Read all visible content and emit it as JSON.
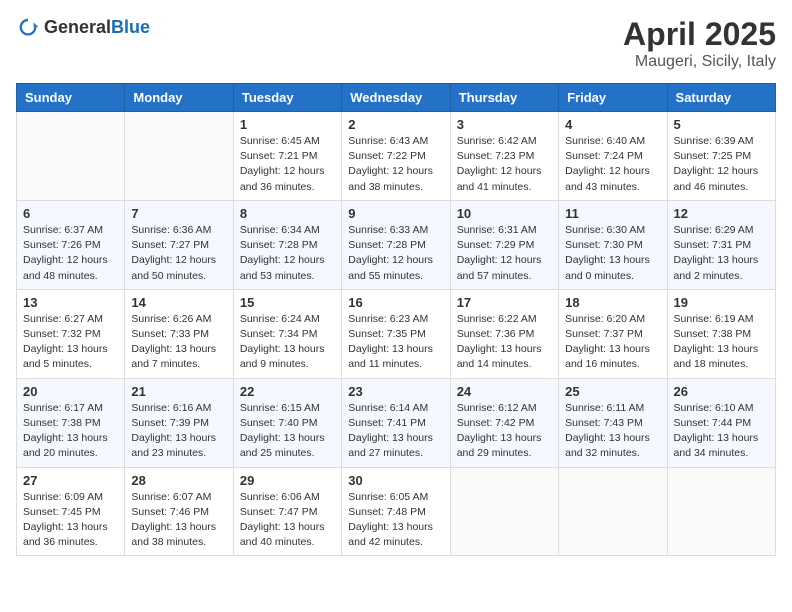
{
  "header": {
    "logo_general": "General",
    "logo_blue": "Blue",
    "month": "April 2025",
    "location": "Maugeri, Sicily, Italy"
  },
  "weekdays": [
    "Sunday",
    "Monday",
    "Tuesday",
    "Wednesday",
    "Thursday",
    "Friday",
    "Saturday"
  ],
  "weeks": [
    [
      {
        "day": "",
        "empty": true
      },
      {
        "day": "",
        "empty": true
      },
      {
        "day": "1",
        "sunrise": "6:45 AM",
        "sunset": "7:21 PM",
        "daylight": "12 hours and 36 minutes."
      },
      {
        "day": "2",
        "sunrise": "6:43 AM",
        "sunset": "7:22 PM",
        "daylight": "12 hours and 38 minutes."
      },
      {
        "day": "3",
        "sunrise": "6:42 AM",
        "sunset": "7:23 PM",
        "daylight": "12 hours and 41 minutes."
      },
      {
        "day": "4",
        "sunrise": "6:40 AM",
        "sunset": "7:24 PM",
        "daylight": "12 hours and 43 minutes."
      },
      {
        "day": "5",
        "sunrise": "6:39 AM",
        "sunset": "7:25 PM",
        "daylight": "12 hours and 46 minutes."
      }
    ],
    [
      {
        "day": "6",
        "sunrise": "6:37 AM",
        "sunset": "7:26 PM",
        "daylight": "12 hours and 48 minutes."
      },
      {
        "day": "7",
        "sunrise": "6:36 AM",
        "sunset": "7:27 PM",
        "daylight": "12 hours and 50 minutes."
      },
      {
        "day": "8",
        "sunrise": "6:34 AM",
        "sunset": "7:28 PM",
        "daylight": "12 hours and 53 minutes."
      },
      {
        "day": "9",
        "sunrise": "6:33 AM",
        "sunset": "7:28 PM",
        "daylight": "12 hours and 55 minutes."
      },
      {
        "day": "10",
        "sunrise": "6:31 AM",
        "sunset": "7:29 PM",
        "daylight": "12 hours and 57 minutes."
      },
      {
        "day": "11",
        "sunrise": "6:30 AM",
        "sunset": "7:30 PM",
        "daylight": "13 hours and 0 minutes."
      },
      {
        "day": "12",
        "sunrise": "6:29 AM",
        "sunset": "7:31 PM",
        "daylight": "13 hours and 2 minutes."
      }
    ],
    [
      {
        "day": "13",
        "sunrise": "6:27 AM",
        "sunset": "7:32 PM",
        "daylight": "13 hours and 5 minutes."
      },
      {
        "day": "14",
        "sunrise": "6:26 AM",
        "sunset": "7:33 PM",
        "daylight": "13 hours and 7 minutes."
      },
      {
        "day": "15",
        "sunrise": "6:24 AM",
        "sunset": "7:34 PM",
        "daylight": "13 hours and 9 minutes."
      },
      {
        "day": "16",
        "sunrise": "6:23 AM",
        "sunset": "7:35 PM",
        "daylight": "13 hours and 11 minutes."
      },
      {
        "day": "17",
        "sunrise": "6:22 AM",
        "sunset": "7:36 PM",
        "daylight": "13 hours and 14 minutes."
      },
      {
        "day": "18",
        "sunrise": "6:20 AM",
        "sunset": "7:37 PM",
        "daylight": "13 hours and 16 minutes."
      },
      {
        "day": "19",
        "sunrise": "6:19 AM",
        "sunset": "7:38 PM",
        "daylight": "13 hours and 18 minutes."
      }
    ],
    [
      {
        "day": "20",
        "sunrise": "6:17 AM",
        "sunset": "7:38 PM",
        "daylight": "13 hours and 20 minutes."
      },
      {
        "day": "21",
        "sunrise": "6:16 AM",
        "sunset": "7:39 PM",
        "daylight": "13 hours and 23 minutes."
      },
      {
        "day": "22",
        "sunrise": "6:15 AM",
        "sunset": "7:40 PM",
        "daylight": "13 hours and 25 minutes."
      },
      {
        "day": "23",
        "sunrise": "6:14 AM",
        "sunset": "7:41 PM",
        "daylight": "13 hours and 27 minutes."
      },
      {
        "day": "24",
        "sunrise": "6:12 AM",
        "sunset": "7:42 PM",
        "daylight": "13 hours and 29 minutes."
      },
      {
        "day": "25",
        "sunrise": "6:11 AM",
        "sunset": "7:43 PM",
        "daylight": "13 hours and 32 minutes."
      },
      {
        "day": "26",
        "sunrise": "6:10 AM",
        "sunset": "7:44 PM",
        "daylight": "13 hours and 34 minutes."
      }
    ],
    [
      {
        "day": "27",
        "sunrise": "6:09 AM",
        "sunset": "7:45 PM",
        "daylight": "13 hours and 36 minutes."
      },
      {
        "day": "28",
        "sunrise": "6:07 AM",
        "sunset": "7:46 PM",
        "daylight": "13 hours and 38 minutes."
      },
      {
        "day": "29",
        "sunrise": "6:06 AM",
        "sunset": "7:47 PM",
        "daylight": "13 hours and 40 minutes."
      },
      {
        "day": "30",
        "sunrise": "6:05 AM",
        "sunset": "7:48 PM",
        "daylight": "13 hours and 42 minutes."
      },
      {
        "day": "",
        "empty": true
      },
      {
        "day": "",
        "empty": true
      },
      {
        "day": "",
        "empty": true
      }
    ]
  ]
}
